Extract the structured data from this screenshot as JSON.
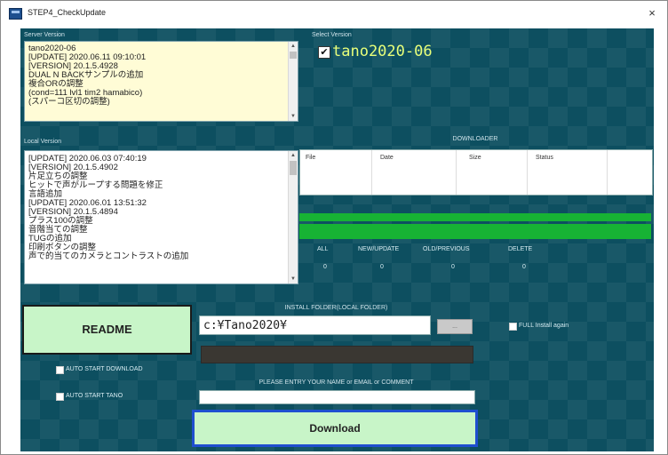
{
  "window": {
    "title": "STEP4_CheckUpdate",
    "close_glyph": "×",
    "icon": "app-icon"
  },
  "server_version": {
    "label": "Server Version",
    "lines": [
      "tano2020-06",
      "[UPDATE] 2020.06.11 09:10:01",
      "[VERSION]                20.1.5.4928",
      "DUAL N BACKサンプルの追加",
      "複合ORの調整",
      "(cond=111 lvl1 tim2 hamabico)",
      "(スパーコ区切の調整)"
    ]
  },
  "select_version": {
    "label": "Select Version",
    "checked_glyph": "✔",
    "value": "tano2020-06"
  },
  "local_version": {
    "label": "Local Version",
    "lines": [
      "[UPDATE] 2020.06.03 07:40:19",
      "[VERSION]                20.1.5.4902",
      "片足立ちの調整",
      "ヒットで声がループする問題を修正",
      "言語追加",
      "[UPDATE] 2020.06.01 13:51:32",
      "[VERSION]                20.1.5.4894",
      "プラス100の調整",
      "音階当ての調整",
      "TUGの追加",
      "印刷ボタンの調整",
      "声で的当てのカメラとコントラストの追加"
    ]
  },
  "downloader": {
    "label": "DOWNLOADER",
    "columns": [
      "File",
      "Date",
      "Size",
      "Status"
    ],
    "progress_1": 1.0,
    "progress_2": 1.0
  },
  "counts": [
    {
      "label": "ALL",
      "value": "0"
    },
    {
      "label": "NEW/UPDATE",
      "value": "0"
    },
    {
      "label": "OLD/PREVIOUS",
      "value": "0"
    },
    {
      "label": "DELETE",
      "value": "0"
    }
  ],
  "readme_label": "README",
  "install": {
    "label": "INSTALL FOLDER(LOCAL FOLDER)",
    "value": "c:¥Tano2020¥",
    "browse_label": "...",
    "full_install_label": "FULL Install again"
  },
  "auto_start_download_label": "AUTO START DOWNLOAD",
  "auto_start_tano_label": "AUTO START TANO",
  "entry_prompt": "PLEASE ENTRY YOUR NAME or EMAIL or COMMENT",
  "download_label": "Download",
  "colors": {
    "client_bg": "#0d4f60",
    "server_box": "#fffcd6",
    "button_green": "#c8f5c8",
    "progress": "#17b334",
    "download_border": "#1f4fd0"
  }
}
